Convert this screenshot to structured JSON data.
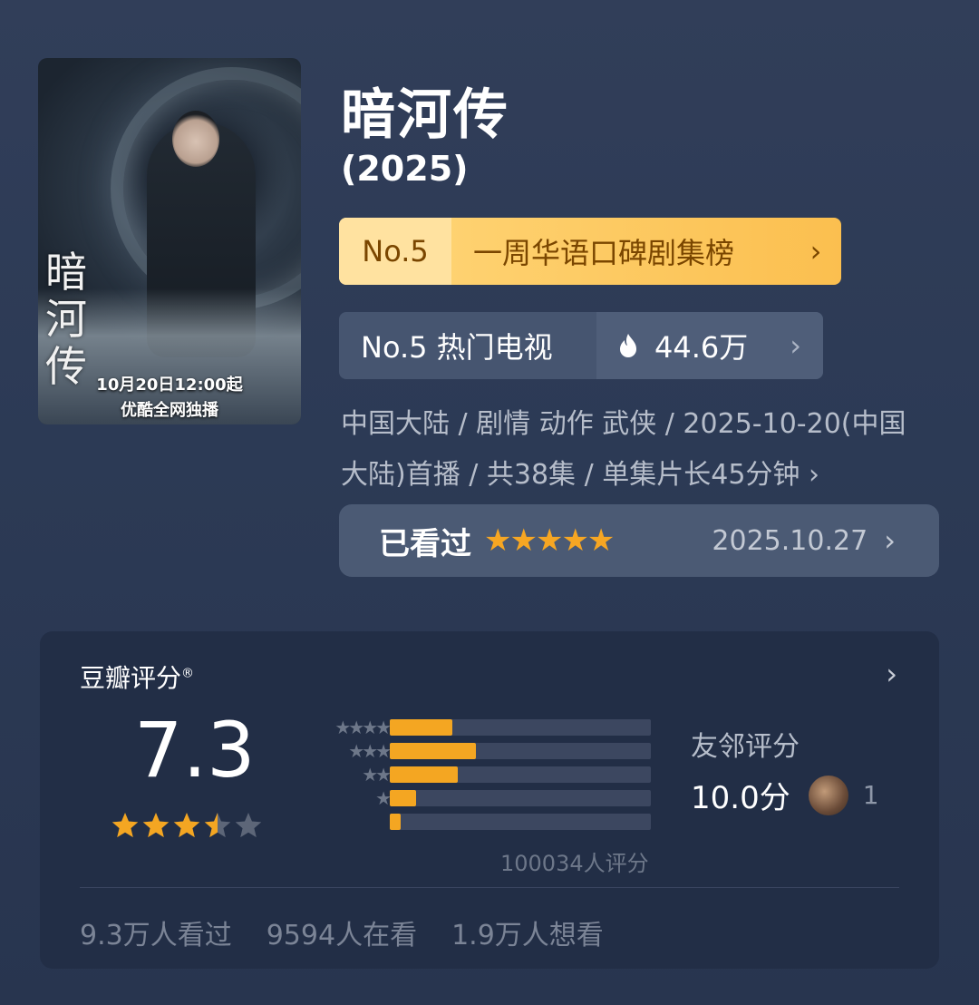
{
  "poster": {
    "calligraphy": "暗河传",
    "caption_line1": "10月20日12:00起",
    "caption_line2": "优酷全网独播"
  },
  "title": "暗河传",
  "year": "(2025)",
  "ranking_primary": {
    "rank": "No.5",
    "label": "一周华语口碑剧集榜"
  },
  "ranking_hot": {
    "label": "No.5 热门电视",
    "heat": "44.6万",
    "flame_color": "#ffffff"
  },
  "meta_line1": "中国大陆 / 剧情 动作 武侠 / 2025-10-20(中国",
  "meta_line2": "大陆)首播 / 共38集 / 单集片长45分钟",
  "watched": {
    "label": "已看过",
    "stars": "★★★★★",
    "user_rating": 5,
    "date": "2025.10.27"
  },
  "rating": {
    "header": "豆瓣评分",
    "registered": "®",
    "score": "7.3",
    "stars_value": 3.5,
    "distribution": [
      {
        "stars": "★★★★★",
        "percent": 24
      },
      {
        "stars": "★★★★",
        "percent": 33
      },
      {
        "stars": "★★★",
        "percent": 26
      },
      {
        "stars": "★★",
        "percent": 10
      },
      {
        "stars": "★",
        "percent": 4
      }
    ],
    "count": "100034人评分",
    "friend_label": "友邻评分",
    "friend_score": "10.0分",
    "friend_count": "1",
    "watched": "9.3万人看过",
    "watching": "9594人在看",
    "wish": "1.9万人想看"
  },
  "colors": {
    "accent": "#f4a622",
    "gold_banner": "#fbbf4f",
    "background": "#2c3a55"
  }
}
